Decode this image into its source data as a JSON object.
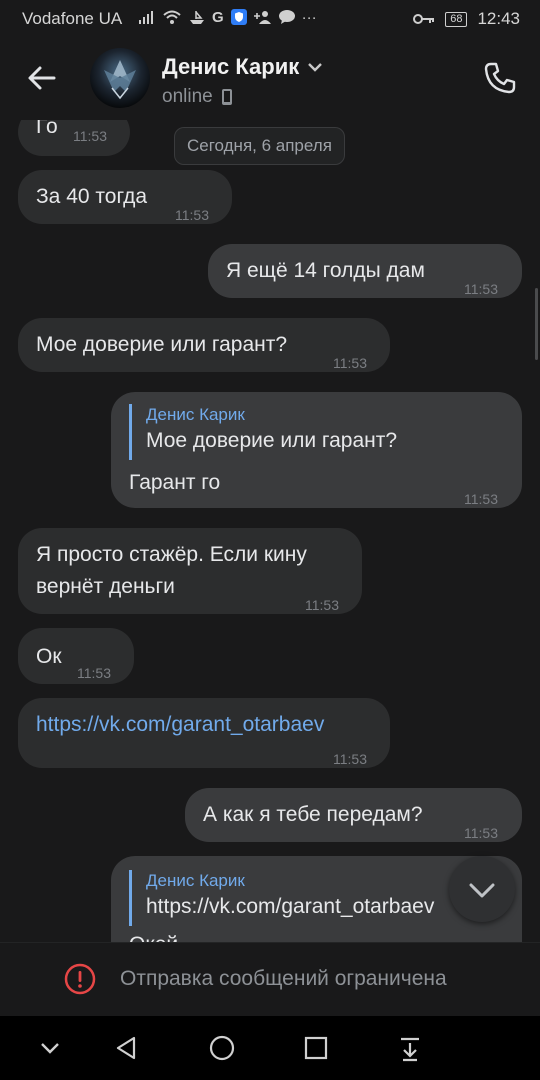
{
  "status_bar": {
    "carrier": "Vodafone UA",
    "battery": "68",
    "time": "12:43"
  },
  "header": {
    "contact_name": "Денис Карик",
    "status": "online"
  },
  "chat": {
    "date_separator": "Сегодня, 6 апреля",
    "messages": [
      {
        "text": "Го",
        "time": "11:53"
      },
      {
        "text": "За 40 тогда",
        "time": "11:53"
      },
      {
        "text": "Я ещё 14 голды дам",
        "time": "11:53"
      },
      {
        "text": "Мое доверие или гарант?",
        "time": "11:53"
      },
      {
        "reply_author": "Денис Карик",
        "reply_text": "Мое доверие или гарант?",
        "text": "Гарант го",
        "time": "11:53"
      },
      {
        "text_line1": "Я просто стажёр. Если кину",
        "text_line2": "вернёт деньги",
        "time": "11:53"
      },
      {
        "text": "Ок",
        "time": "11:53"
      },
      {
        "text": "https://vk.com/garant_otarbaev",
        "time": "11:53"
      },
      {
        "text": "А как я тебе передам?",
        "time": "11:53"
      },
      {
        "reply_author": "Денис Карик",
        "reply_text": "https://vk.com/garant_otarbaev",
        "text": "Окей"
      }
    ]
  },
  "restricted_notice": "Отправка сообщений ограничена",
  "colors": {
    "background": "#19191a",
    "incoming_bubble": "#2c2d2e",
    "outgoing_bubble": "#3a3b3d",
    "link": "#71aaeb",
    "warning": "#e64646"
  },
  "icons": [
    "back-arrow-icon",
    "avatar",
    "chevron-down-icon",
    "phone-device-icon",
    "call-icon",
    "scroll-down-icon",
    "warning-icon",
    "nav-hide-icon",
    "nav-back-icon",
    "nav-home-icon",
    "nav-recents-icon",
    "nav-notifications-icon"
  ]
}
